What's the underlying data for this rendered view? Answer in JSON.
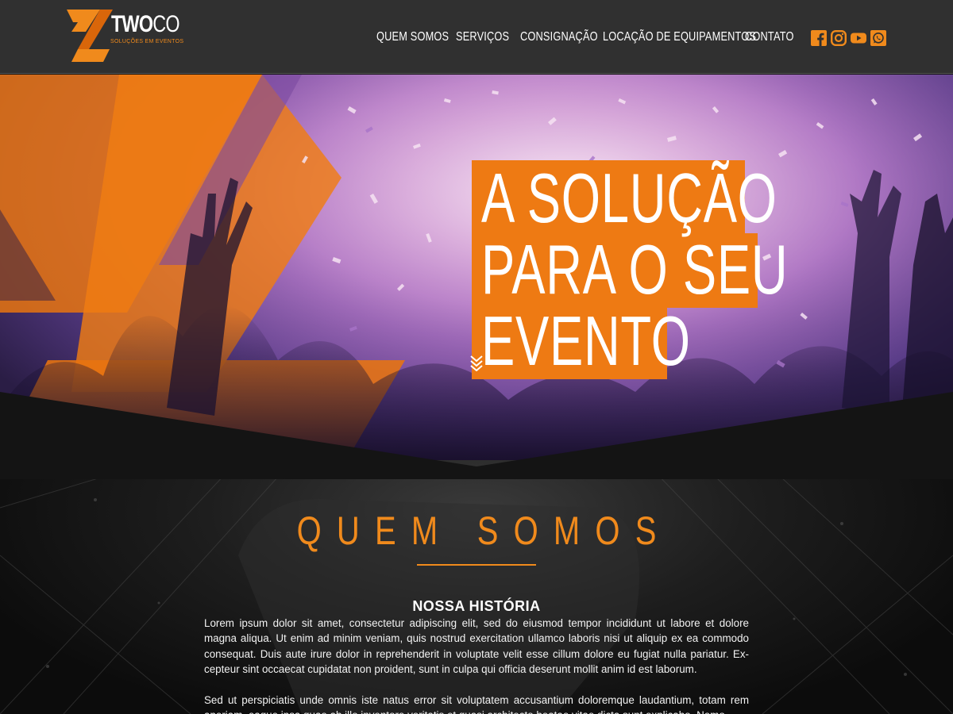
{
  "header": {
    "logo": {
      "word_main": "TWO",
      "word_co": "CO",
      "tagline": "SOLUÇÕES EM EVENTOS"
    },
    "nav": [
      {
        "label": "QUEM SOMOS"
      },
      {
        "label": "SERVIÇOS"
      },
      {
        "label": "CONSIGNAÇÃO"
      },
      {
        "label": "LOCAÇÃO DE EQUIPAMENTOS"
      },
      {
        "label": "CONTATO"
      }
    ],
    "social_icons": [
      "facebook-icon",
      "instagram-icon",
      "youtube-icon",
      "whatsapp-icon"
    ]
  },
  "hero": {
    "lines": [
      "A SOLUÇÃO",
      "PARA O SEU",
      "EVENTO"
    ],
    "scroll_icon": "chevron-double-down-icon"
  },
  "about": {
    "title": "QUEM SOMOS",
    "subtitle": "NOSSA HISTÓRIA",
    "paragraph_1": "Lorem ipsum dolor sit amet, consectetur adipiscing elit, sed do eiusmod tempor incididunt ut labore et dolore magna aliqua. Ut enim ad minim veniam, quis nostrud exercitation ullamco laboris nisi ut aliquip ex ea commodo consequat. Duis aute irure dolor in reprehenderit in voluptate velit esse cillum dolore eu fugiat nulla pariatur. Ex­cepteur sint occaecat cupidatat non proident, sunt in culpa qui officia deserunt mollit anim id est laborum.",
    "paragraph_2": "Sed ut perspiciatis unde omnis iste natus error sit voluptatem accusantium doloremque laudantium, totam rem aperiam, eaque ipsa quae ab illo inventore veritatis et quasi architecto beatae vitae dicta sunt explicabo. Nemo"
  },
  "colors": {
    "accent": "#f08a1c",
    "header_bg": "#303030",
    "hero_box": "#ee7a13"
  }
}
